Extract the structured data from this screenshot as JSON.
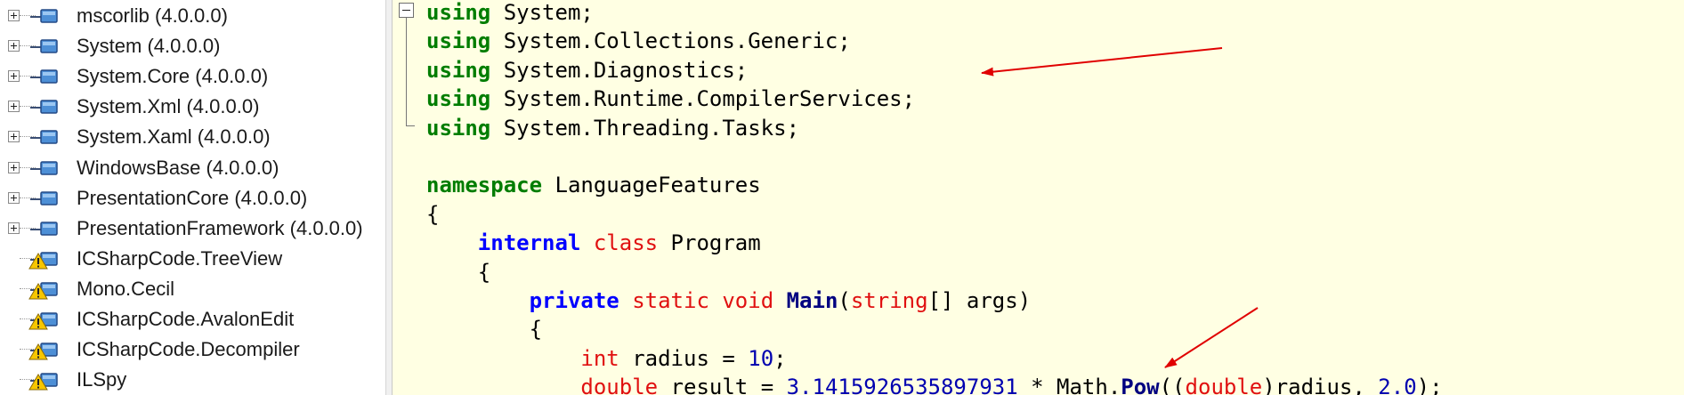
{
  "tree": {
    "items": [
      {
        "label": "mscorlib (4.0.0.0)",
        "expandable": true,
        "warning": false
      },
      {
        "label": "System (4.0.0.0)",
        "expandable": true,
        "warning": false
      },
      {
        "label": "System.Core (4.0.0.0)",
        "expandable": true,
        "warning": false
      },
      {
        "label": "System.Xml (4.0.0.0)",
        "expandable": true,
        "warning": false
      },
      {
        "label": "System.Xaml (4.0.0.0)",
        "expandable": true,
        "warning": false
      },
      {
        "label": "WindowsBase (4.0.0.0)",
        "expandable": true,
        "warning": false
      },
      {
        "label": "PresentationCore (4.0.0.0)",
        "expandable": true,
        "warning": false
      },
      {
        "label": "PresentationFramework (4.0.0.0)",
        "expandable": true,
        "warning": false
      },
      {
        "label": "ICSharpCode.TreeView",
        "expandable": false,
        "warning": true
      },
      {
        "label": "Mono.Cecil",
        "expandable": false,
        "warning": true
      },
      {
        "label": "ICSharpCode.AvalonEdit",
        "expandable": false,
        "warning": true
      },
      {
        "label": "ICSharpCode.Decompiler",
        "expandable": false,
        "warning": true
      },
      {
        "label": "ILSpy",
        "expandable": false,
        "warning": true
      }
    ]
  },
  "code": {
    "lines": [
      [
        {
          "t": "using",
          "c": "kw-green"
        },
        {
          "t": " System;"
        }
      ],
      [
        {
          "t": "using",
          "c": "kw-green"
        },
        {
          "t": " System.Collections.Generic;"
        }
      ],
      [
        {
          "t": "using",
          "c": "kw-green"
        },
        {
          "t": " System.Diagnostics;"
        }
      ],
      [
        {
          "t": "using",
          "c": "kw-green"
        },
        {
          "t": " System.Runtime.CompilerServices;"
        }
      ],
      [
        {
          "t": "using",
          "c": "kw-green"
        },
        {
          "t": " System.Threading.Tasks;"
        }
      ],
      [],
      [
        {
          "t": "namespace",
          "c": "kw-green"
        },
        {
          "t": " LanguageFeatures"
        }
      ],
      [
        {
          "t": "{"
        }
      ],
      [
        {
          "t": "    "
        },
        {
          "t": "internal",
          "c": "kw-blue"
        },
        {
          "t": " "
        },
        {
          "t": "class",
          "c": "kw-red"
        },
        {
          "t": " Program"
        }
      ],
      [
        {
          "t": "    {"
        }
      ],
      [
        {
          "t": "        "
        },
        {
          "t": "private",
          "c": "kw-blue"
        },
        {
          "t": " "
        },
        {
          "t": "static",
          "c": "kw-red"
        },
        {
          "t": " "
        },
        {
          "t": "void",
          "c": "kw-red"
        },
        {
          "t": " "
        },
        {
          "t": "Main",
          "c": "id-bold"
        },
        {
          "t": "("
        },
        {
          "t": "string",
          "c": "kw-red"
        },
        {
          "t": "[] args)"
        }
      ],
      [
        {
          "t": "        {"
        }
      ],
      [
        {
          "t": "            "
        },
        {
          "t": "int",
          "c": "kw-red"
        },
        {
          "t": " radius = "
        },
        {
          "t": "10",
          "c": "num"
        },
        {
          "t": ";"
        }
      ],
      [
        {
          "t": "            "
        },
        {
          "t": "double",
          "c": "kw-red"
        },
        {
          "t": " result = "
        },
        {
          "t": "3.1415926535897931",
          "c": "num"
        },
        {
          "t": " * Math."
        },
        {
          "t": "Pow",
          "c": "id-bold"
        },
        {
          "t": "(("
        },
        {
          "t": "double",
          "c": "kw-red"
        },
        {
          "t": ")radius, "
        },
        {
          "t": "2.0",
          "c": "num"
        },
        {
          "t": ");"
        }
      ]
    ]
  },
  "colors": {
    "code_background": "#ffffe3",
    "keyword_green": "#007d00",
    "keyword_blue": "#0000ff",
    "keyword_red": "#e01010",
    "annotation_arrow": "#e00000"
  }
}
